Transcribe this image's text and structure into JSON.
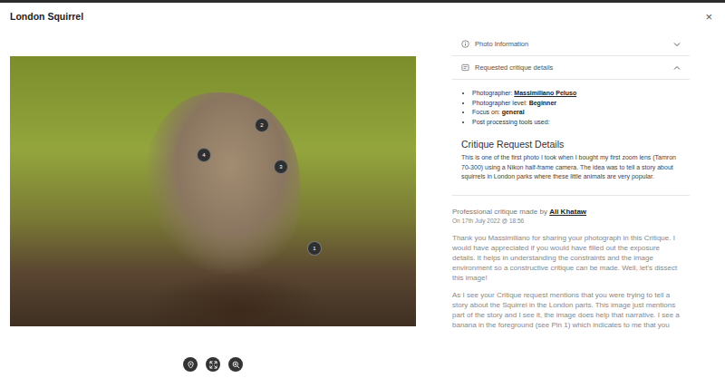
{
  "window": {
    "title": "London Squirrel",
    "close": "×"
  },
  "photo": {
    "pins": [
      {
        "label": "1"
      },
      {
        "label": "2"
      },
      {
        "label": "3"
      },
      {
        "label": "4"
      }
    ]
  },
  "accordion": [
    {
      "label": "Photo Information",
      "expanded": false
    },
    {
      "label": "Requested critique details",
      "expanded": true
    }
  ],
  "details": [
    {
      "label": "Photographer:",
      "value": "Massimiliano Peluso",
      "link": true
    },
    {
      "label": "Photographer level:",
      "value": "Beginner",
      "link": false
    },
    {
      "label": "Focus on:",
      "value": "general",
      "link": false
    },
    {
      "label": "Post processing tools used:",
      "link": false
    }
  ],
  "request": {
    "heading": "Critique Request Details",
    "text": "This is one of the first photo I took when I bought my first zoom lens (Tamron 70-300) using a Nikon half-frame camera. The idea was to tell a story about squirrels in London parks where these little animals are very popular."
  },
  "critique": {
    "intro": "Professional critique made by",
    "author": "Ali Khataw",
    "date": "On 17th July 2022 @ 18:56",
    "paragraphs": [
      "Thank you Massimiliano for sharing your photograph in this Critique. I would have appreciated if you would have filled out the exposure details. It helps in understanding the constraints and the image environment so a constructive critique can be made. Well, let's dissect this image!",
      "As I see your Critique request mentions that you were trying to tell a story about the Squirrel in the London parts. This image just mentions part of the story and I see it, the image does help that narrative. I see a banana in the foreground (see Pin 1) which indicates to me that you"
    ]
  }
}
